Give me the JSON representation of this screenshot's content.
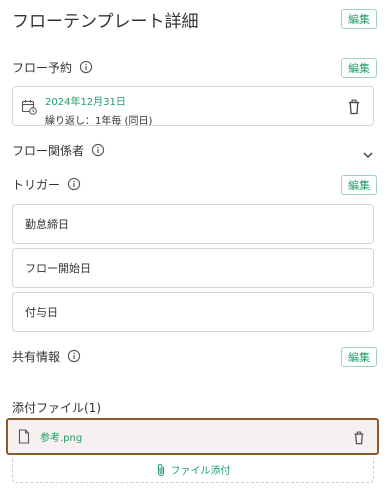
{
  "header": {
    "title": "フローテンプレート詳細",
    "edit_label": "編集"
  },
  "booking": {
    "label": "フロー予約",
    "edit_label": "編集",
    "date": "2024年12月31日",
    "repeat": "繰り返し：1年毎 (同日)"
  },
  "stakeholders": {
    "label": "フロー関係者"
  },
  "trigger": {
    "label": "トリガー",
    "edit_label": "編集",
    "items": [
      "勤怠締日",
      "フロー開始日",
      "付与日"
    ]
  },
  "sharing": {
    "label": "共有情報",
    "edit_label": "編集"
  },
  "attachments": {
    "label": "添付ファイル(1)",
    "files": [
      {
        "name": "参考.png"
      }
    ],
    "add_label": "ファイル添付"
  },
  "colors": {
    "accent": "#1e9e6a",
    "highlight_border": "#8a5a2b"
  }
}
